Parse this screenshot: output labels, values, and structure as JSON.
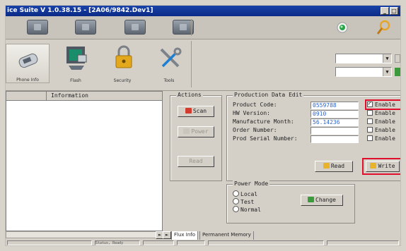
{
  "window": {
    "title": "ice Suite V 1.0.38.15 - [2A06/9842.Dev1]"
  },
  "tools": [
    {
      "label": "Phone Info"
    },
    {
      "label": "Flash"
    },
    {
      "label": "Security"
    },
    {
      "label": "Tools"
    }
  ],
  "list": {
    "columns": [
      "",
      "Information"
    ]
  },
  "actions": {
    "title": "Actions",
    "scan_label": "Scan",
    "power_label": "Power",
    "read_label": "Read"
  },
  "production": {
    "title": "Production Data Edit",
    "fields": [
      {
        "label": "Product Code:",
        "value": "0559788",
        "enable": "Enable",
        "checked": true
      },
      {
        "label": "HW Version:",
        "value": "0910",
        "enable": "Enable",
        "checked": false
      },
      {
        "label": "Manufacture Month:",
        "value": "56.14236",
        "enable": "Enable",
        "checked": false
      },
      {
        "label": "Order Number:",
        "value": "",
        "enable": "Enable",
        "checked": false
      },
      {
        "label": "Prod Serial Number:",
        "value": "",
        "enable": "Enable",
        "checked": false
      }
    ],
    "read_label": "Read",
    "write_label": "Write"
  },
  "power_mode": {
    "title": "Power Mode",
    "options": [
      "Local",
      "Test",
      "Normal"
    ],
    "change_label": "Change"
  },
  "tabs": [
    "Flux Info",
    "Permanent Memory"
  ],
  "status": {
    "panel1": "",
    "panel2": "Status, Ready"
  },
  "colors": {
    "highlight": "#e0102c",
    "titlebar": "#0b2a86",
    "value_text": "#2a64c8"
  }
}
